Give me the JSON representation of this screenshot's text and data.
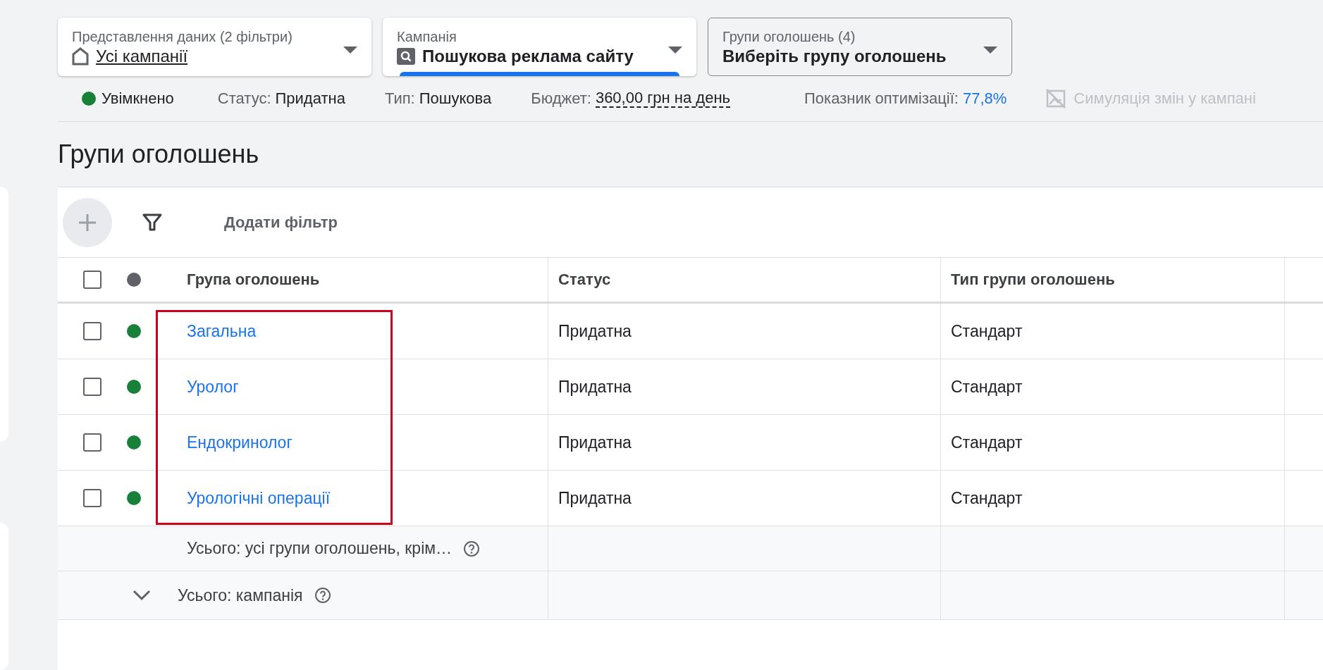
{
  "selectors": [
    {
      "kind": "view",
      "label": "Представлення даних (2 фільтри)",
      "value": "Усі кампанії",
      "selected": false
    },
    {
      "kind": "campaign",
      "label": "Кампанія",
      "value": "Пошукова реклама сайту",
      "selected": true
    },
    {
      "kind": "ad_group",
      "label": "Групи оголошень (4)",
      "value": "Виберіть групу оголошень",
      "selected": false
    }
  ],
  "status_bar": {
    "state": "Увімкнено",
    "enabled": true,
    "status_label": "Статус:",
    "status_value": "Придатна",
    "type_label": "Тип:",
    "type_value": "Пошукова",
    "budget_label": "Бюджет:",
    "budget_value": "360,00 грн на день",
    "score_label": "Показник оптимізації:",
    "score_value": "77,8%",
    "simulation": "Симуляція змін у кампані",
    "simulation_disabled": true
  },
  "title": "Групи оголошень",
  "toolbar": {
    "add_filter": "Додати фільтр"
  },
  "table": {
    "all_checked": false,
    "columns": [
      "Група оголошень",
      "Статус",
      "Тип групи оголошень"
    ],
    "rows": [
      {
        "name": "Загальна",
        "status": "Придатна",
        "type": "Стандарт",
        "checked": false,
        "enabled": true
      },
      {
        "name": "Уролог",
        "status": "Придатна",
        "type": "Стандарт",
        "checked": false,
        "enabled": true
      },
      {
        "name": "Ендокринолог",
        "status": "Придатна",
        "type": "Стандарт",
        "checked": false,
        "enabled": true
      },
      {
        "name": "Урологічні операції",
        "status": "Придатна",
        "type": "Стандарт",
        "checked": false,
        "enabled": true
      }
    ],
    "highlight_rows": true,
    "totals": [
      {
        "kind": "filtered",
        "label": "Усього: усі групи оголошень, крім…"
      },
      {
        "kind": "campaign",
        "label": "Усього: кампанія",
        "expanded": true
      }
    ]
  }
}
